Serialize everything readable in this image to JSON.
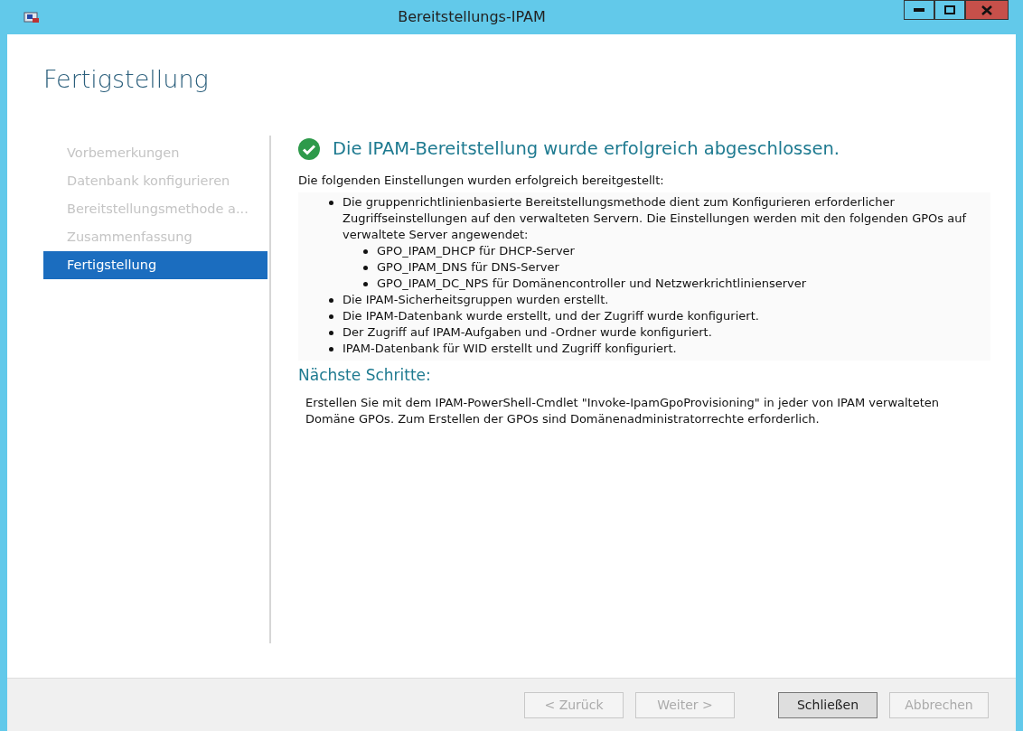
{
  "window": {
    "title": "Bereitstellungs-IPAM"
  },
  "page_title": "Fertigstellung",
  "steps": [
    {
      "label": "Vorbemerkungen",
      "selected": false
    },
    {
      "label": "Datenbank konfigurieren",
      "selected": false
    },
    {
      "label": "Bereitstellungsmethode a...",
      "selected": false
    },
    {
      "label": "Zusammenfassung",
      "selected": false
    },
    {
      "label": "Fertigstellung",
      "selected": true
    }
  ],
  "result": {
    "heading": "Die IPAM-Bereitstellung wurde erfolgreich abgeschlossen.",
    "intro": "Die folgenden Einstellungen wurden erfolgreich bereitgestellt:",
    "items": [
      {
        "text": "Die gruppenrichtlinienbasierte Bereitstellungsmethode dient zum Konfigurieren erforderlicher Zugriffseinstellungen auf den verwalteten Servern. Die Einstellungen werden mit den folgenden GPOs auf verwaltete Server angewendet:",
        "children": [
          {
            "text": "GPO_IPAM_DHCP für DHCP-Server"
          },
          {
            "text": "GPO_IPAM_DNS für DNS-Server"
          },
          {
            "text": "GPO_IPAM_DC_NPS für Domänencontroller und Netzwerkrichtlinienserver"
          }
        ]
      },
      {
        "text": "Die IPAM-Sicherheitsgruppen wurden erstellt."
      },
      {
        "text": "Die IPAM-Datenbank wurde erstellt, und der Zugriff wurde konfiguriert."
      },
      {
        "text": "Der Zugriff auf IPAM-Aufgaben und -Ordner wurde konfiguriert."
      },
      {
        "text": "IPAM-Datenbank für WID erstellt und Zugriff konfiguriert."
      }
    ]
  },
  "next_steps": {
    "heading": "Nächste Schritte:",
    "text": "Erstellen Sie mit dem IPAM-PowerShell-Cmdlet \"Invoke-IpamGpoProvisioning\" in jeder von IPAM verwalteten Domäne GPOs. Zum Erstellen der GPOs sind Domänenadministratorrechte erforderlich."
  },
  "buttons": [
    {
      "label": "< Zurück",
      "disabled": true,
      "default": false
    },
    {
      "label": "Weiter >",
      "disabled": true,
      "default": false
    },
    {
      "label": "Schließen",
      "disabled": false,
      "default": true
    },
    {
      "label": "Abbrechen",
      "disabled": true,
      "default": false
    }
  ]
}
